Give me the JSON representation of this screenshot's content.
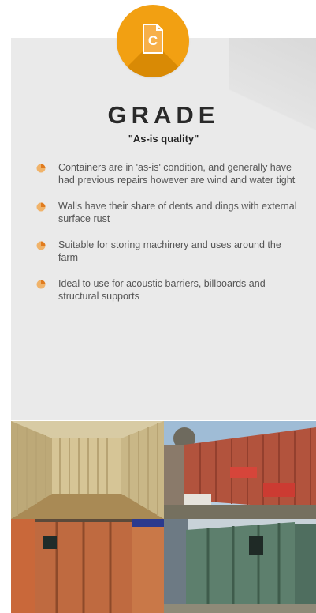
{
  "grade": {
    "badge_letter": "C",
    "title": "GRADE",
    "subtitle": "\"As-is quality\"",
    "accent_color": "#f2a012"
  },
  "features": [
    "Containers are in 'as-is' condition, and generally have had previous repairs however are wind and water tight",
    "Walls have their share of dents and dings with external surface rust",
    "Suitable for storing machinery and uses around the farm",
    "Ideal to use for acoustic barriers, billboards and structural supports"
  ],
  "bullet_icon": "orange-bullet-icon",
  "photos": [
    "container-interior-photo",
    "red-container-exterior-photo",
    "orange-container-doors-photo",
    "green-container-doors-photo"
  ]
}
